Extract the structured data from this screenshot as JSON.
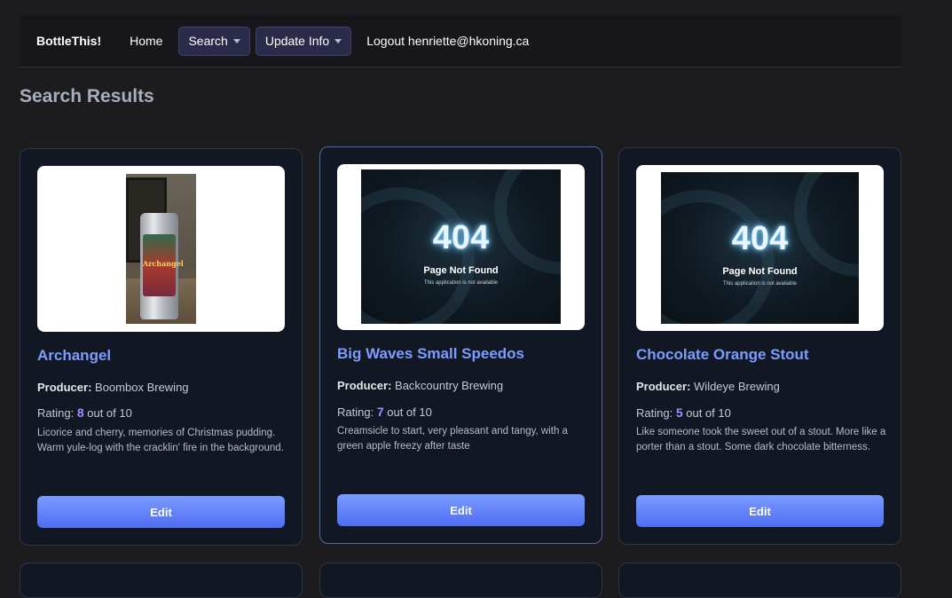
{
  "nav": {
    "brand": "BottleThis!",
    "home": "Home",
    "search": "Search",
    "update": "Update Info",
    "logout": "Logout henriette@hkoning.ca"
  },
  "page": {
    "title": "Search Results"
  },
  "colors": {
    "accent": "#7c9cff",
    "rating": "#a98bff",
    "button": "#5b7bf5"
  },
  "cards": [
    {
      "title": "Archangel",
      "producer_label": "Producer:",
      "producer": "Boombox Brewing",
      "rating_prefix": "Rating:",
      "rating": "8",
      "rating_suffix": "out of 10",
      "description": "Licorice and cherry, memories of Christmas pudding. Warm yule-log with the cracklin' fire in the background.",
      "image_text": "Archangel",
      "edit": "Edit"
    },
    {
      "title": "Big Waves Small Speedos",
      "producer_label": "Producer:",
      "producer": "Backcountry Brewing",
      "rating_prefix": "Rating:",
      "rating": "7",
      "rating_suffix": "out of 10",
      "description": "Creamsicle to start, very pleasant and tangy, with a green apple freezy after taste",
      "image_code": "404",
      "image_title": "Page Not Found",
      "image_sub": "This application is not available",
      "edit": "Edit"
    },
    {
      "title": "Chocolate Orange Stout",
      "producer_label": "Producer:",
      "producer": "Wildeye Brewing",
      "rating_prefix": "Rating:",
      "rating": "5",
      "rating_suffix": "out of 10",
      "description": "Like someone took the sweet out of a stout. More like a porter than a stout. Some dark chocolate bitterness.",
      "image_code": "404",
      "image_title": "Page Not Found",
      "image_sub": "This application is not available",
      "edit": "Edit"
    }
  ]
}
